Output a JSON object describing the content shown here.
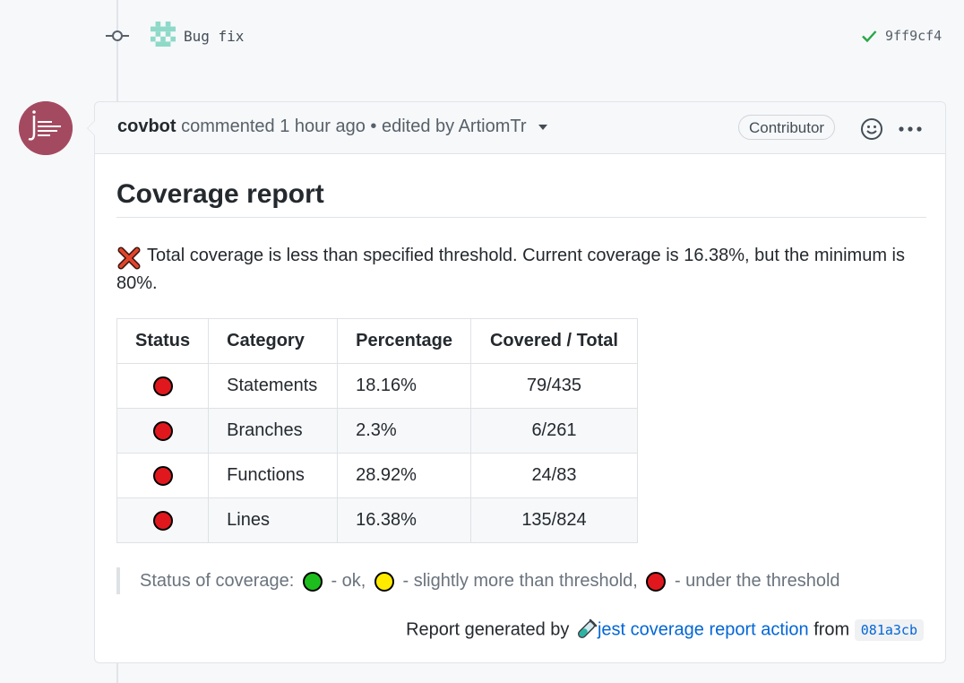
{
  "commit": {
    "message": "Bug fix",
    "sha": "9ff9cf4"
  },
  "comment": {
    "author": "covbot",
    "action": "commented",
    "time": "1 hour ago",
    "separator": "•",
    "edited_prefix": "edited by",
    "editor": "ArtiomTr",
    "role_badge": "Contributor",
    "avatar_logo_text": "jest coverage report action"
  },
  "report": {
    "title": "Coverage report",
    "warning": "Total coverage is less than specified threshold. Current coverage is 16.38%, but the minimum is 80%.",
    "table": {
      "headers": [
        "Status",
        "Category",
        "Percentage",
        "Covered / Total"
      ],
      "rows": [
        {
          "status": "red",
          "category": "Statements",
          "percentage": "18.16%",
          "covered": "79/435"
        },
        {
          "status": "red",
          "category": "Branches",
          "percentage": "2.3%",
          "covered": "6/261"
        },
        {
          "status": "red",
          "category": "Functions",
          "percentage": "28.92%",
          "covered": "24/83"
        },
        {
          "status": "red",
          "category": "Lines",
          "percentage": "16.38%",
          "covered": "135/824"
        }
      ]
    },
    "legend": {
      "prefix": "Status of coverage:",
      "ok": "- ok,",
      "slightly": "- slightly more than threshold,",
      "under": "- under the threshold"
    },
    "footer": {
      "prefix": "Report generated by",
      "link": "jest coverage report action",
      "from": "from",
      "sha": "081a3cb"
    }
  },
  "colors": {
    "status_red": "#e0181d",
    "status_green": "#1ebd1e",
    "status_yellow": "#ffeb00",
    "link": "#0366d6",
    "avatar_bg": "#a44a60"
  }
}
